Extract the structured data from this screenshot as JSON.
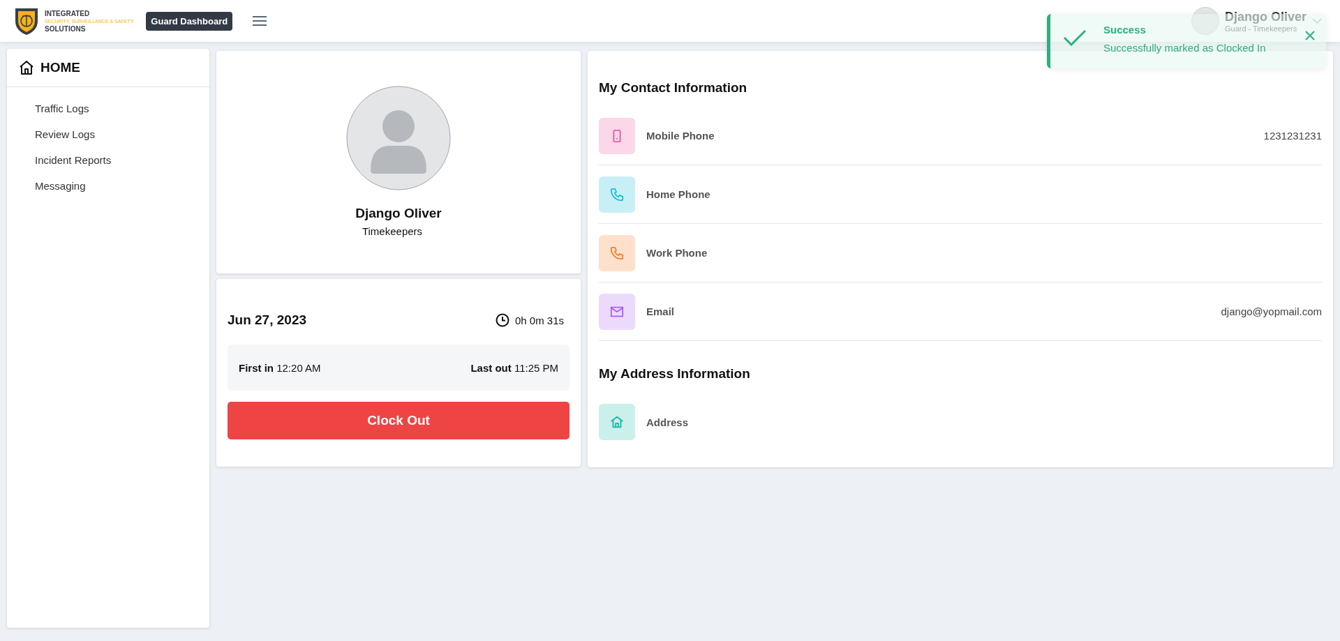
{
  "header": {
    "logo": {
      "line1": "INTEGRATED",
      "line2": "SECURITY, SURVEILLANCE & SAFETY",
      "line3": "SOLUTIONS"
    },
    "badge": "Guard Dashboard",
    "user": {
      "name": "Django Oliver",
      "role": "Guard - Timekeepers"
    }
  },
  "toast": {
    "title": "Success",
    "message": "Successfully marked as Clocked In"
  },
  "sidebar": {
    "title": "HOME",
    "items": [
      {
        "label": "Traffic Logs"
      },
      {
        "label": "Review Logs"
      },
      {
        "label": "Incident Reports"
      },
      {
        "label": "Messaging"
      }
    ]
  },
  "profile": {
    "name": "Django Oliver",
    "group": "Timekeepers"
  },
  "attendance": {
    "date": "Jun 27, 2023",
    "elapsed": "0h 0m 31s",
    "first_in_label": "First in",
    "first_in": "12:20 AM",
    "last_out_label": "Last out",
    "last_out": "11:25 PM",
    "button": "Clock Out"
  },
  "contact": {
    "title": "My Contact Information",
    "items": [
      {
        "kind": "mobile",
        "label": "Mobile Phone",
        "value": "1231231231",
        "color": "#ec4899"
      },
      {
        "kind": "phone",
        "label": "Home Phone",
        "color": "#06b6d4"
      },
      {
        "kind": "phone",
        "label": "Work Phone",
        "color": "#f97316"
      },
      {
        "kind": "email",
        "label": "Email",
        "value": "django@yopmail.com",
        "color": "#a855f7"
      }
    ]
  },
  "address": {
    "title": "My Address Information",
    "items": [
      {
        "kind": "home",
        "label": "Address",
        "color": "#14b8a6"
      }
    ]
  }
}
